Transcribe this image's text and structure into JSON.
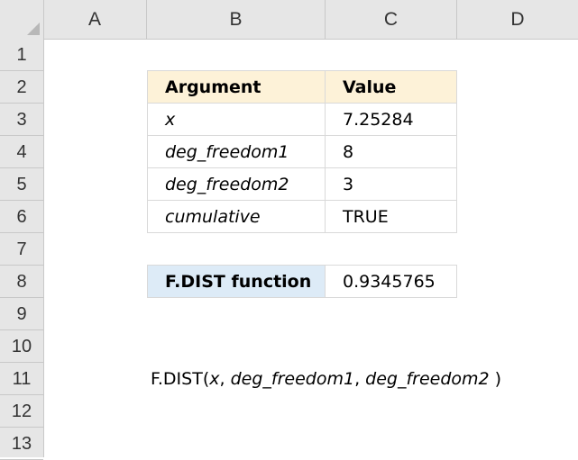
{
  "columns": [
    "A",
    "B",
    "C",
    "D"
  ],
  "rows": [
    "1",
    "2",
    "3",
    "4",
    "5",
    "6",
    "7",
    "8",
    "9",
    "10",
    "11",
    "12",
    "13"
  ],
  "table": {
    "header": {
      "argument": "Argument",
      "value": "Value"
    },
    "rows": [
      {
        "argument": "x",
        "value": "7.25284"
      },
      {
        "argument": "deg_freedom1",
        "value": "8"
      },
      {
        "argument": "deg_freedom2",
        "value": "3"
      },
      {
        "argument": "cumulative",
        "value": "TRUE"
      }
    ]
  },
  "result": {
    "label": "F.DIST function",
    "value": "0.9345765"
  },
  "formula": {
    "prefix": "F.DIST(",
    "args": [
      "x",
      "deg_freedom1",
      "deg_freedom2"
    ],
    "sep1": ", ",
    "sep2": ", ",
    "suffix": " )"
  },
  "colors": {
    "header_fill": "#fdf2d8",
    "result_fill": "#ddebf7",
    "grid": "#d9d9d9"
  }
}
